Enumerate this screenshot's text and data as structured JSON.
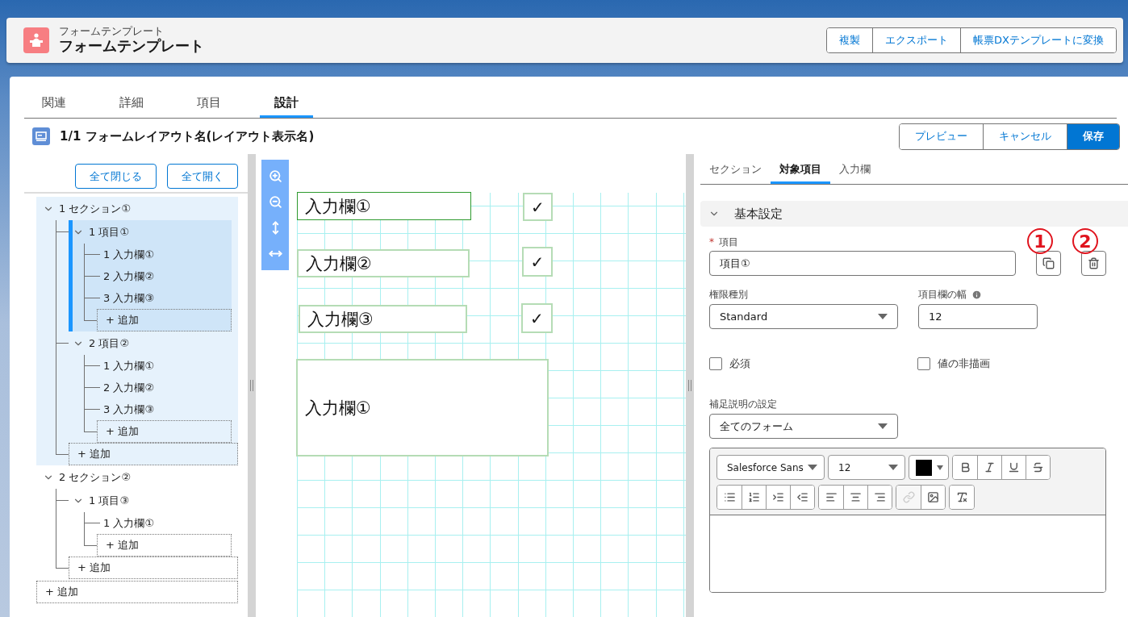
{
  "header": {
    "object_label": "フォームテンプレート",
    "title": "フォームテンプレート",
    "actions": [
      {
        "label": "複製"
      },
      {
        "label": "エクスポート"
      },
      {
        "label": "帳票DXテンプレートに変換"
      }
    ]
  },
  "tabs": [
    {
      "label": "関連",
      "selected": false
    },
    {
      "label": "詳細",
      "selected": false
    },
    {
      "label": "項目",
      "selected": false
    },
    {
      "label": "設計",
      "selected": true
    }
  ],
  "layout": {
    "title": "1/1 フォームレイアウト名(レイアウト表示名)",
    "actions": [
      {
        "label": "プレビュー",
        "kind": "neutral"
      },
      {
        "label": "キャンセル",
        "kind": "neutral"
      },
      {
        "label": "保存",
        "kind": "brand"
      }
    ]
  },
  "tree": {
    "buttons": [
      "全て閉じる",
      "全て開く"
    ],
    "sections": [
      {
        "label": "1 セクション①",
        "expanded": true,
        "selected": true,
        "add": "+ 追加",
        "children": [
          {
            "label": "1 項目①",
            "expanded": true,
            "selected": true,
            "add": "+ 追加",
            "children": [
              {
                "label": "1 入力欄①"
              },
              {
                "label": "2 入力欄②"
              },
              {
                "label": "3 入力欄③"
              }
            ]
          },
          {
            "label": "2 項目②",
            "expanded": true,
            "selected": false,
            "add": "+ 追加",
            "children": [
              {
                "label": "1 入力欄①"
              },
              {
                "label": "2 入力欄②"
              },
              {
                "label": "3 入力欄③"
              }
            ]
          }
        ]
      },
      {
        "label": "2 セクション②",
        "expanded": true,
        "selected": false,
        "add": "+ 追加",
        "children": [
          {
            "label": "1 項目③",
            "expanded": true,
            "selected": false,
            "add": "+ 追加",
            "children": [
              {
                "label": "1 入力欄①"
              }
            ]
          }
        ]
      }
    ],
    "add": "+ 追加"
  },
  "canvas": {
    "items": [
      {
        "kind": "field",
        "label": "入力欄①",
        "selected": true
      },
      {
        "kind": "field",
        "label": "入力欄②",
        "selected": false
      },
      {
        "kind": "field",
        "label": "入力欄③",
        "selected": false
      },
      {
        "kind": "area",
        "label": "入力欄①",
        "selected": false
      }
    ],
    "checks": [
      "✓",
      "✓",
      "✓"
    ]
  },
  "panel": {
    "tabs": [
      {
        "label": "セクション",
        "selected": false
      },
      {
        "label": "対象項目",
        "selected": true
      },
      {
        "label": "入力欄",
        "selected": false
      }
    ],
    "accordion": {
      "title": "基本設定",
      "expanded": true
    },
    "item_field": {
      "label": "項目",
      "required_mark": "*",
      "value": "項目①"
    },
    "markers": [
      "1",
      "2"
    ],
    "permission": {
      "label": "権限種別",
      "value": "Standard"
    },
    "width": {
      "label": "項目欄の幅",
      "value": "12"
    },
    "checkboxes": [
      {
        "label": "必須",
        "checked": false
      },
      {
        "label": "値の非描画",
        "checked": false
      }
    ],
    "help_setting": {
      "label": "補足説明の設定",
      "value": "全てのフォーム"
    },
    "editor": {
      "font": "Salesforce Sans",
      "size": "12",
      "color": "#000000",
      "link_disabled": true
    }
  }
}
